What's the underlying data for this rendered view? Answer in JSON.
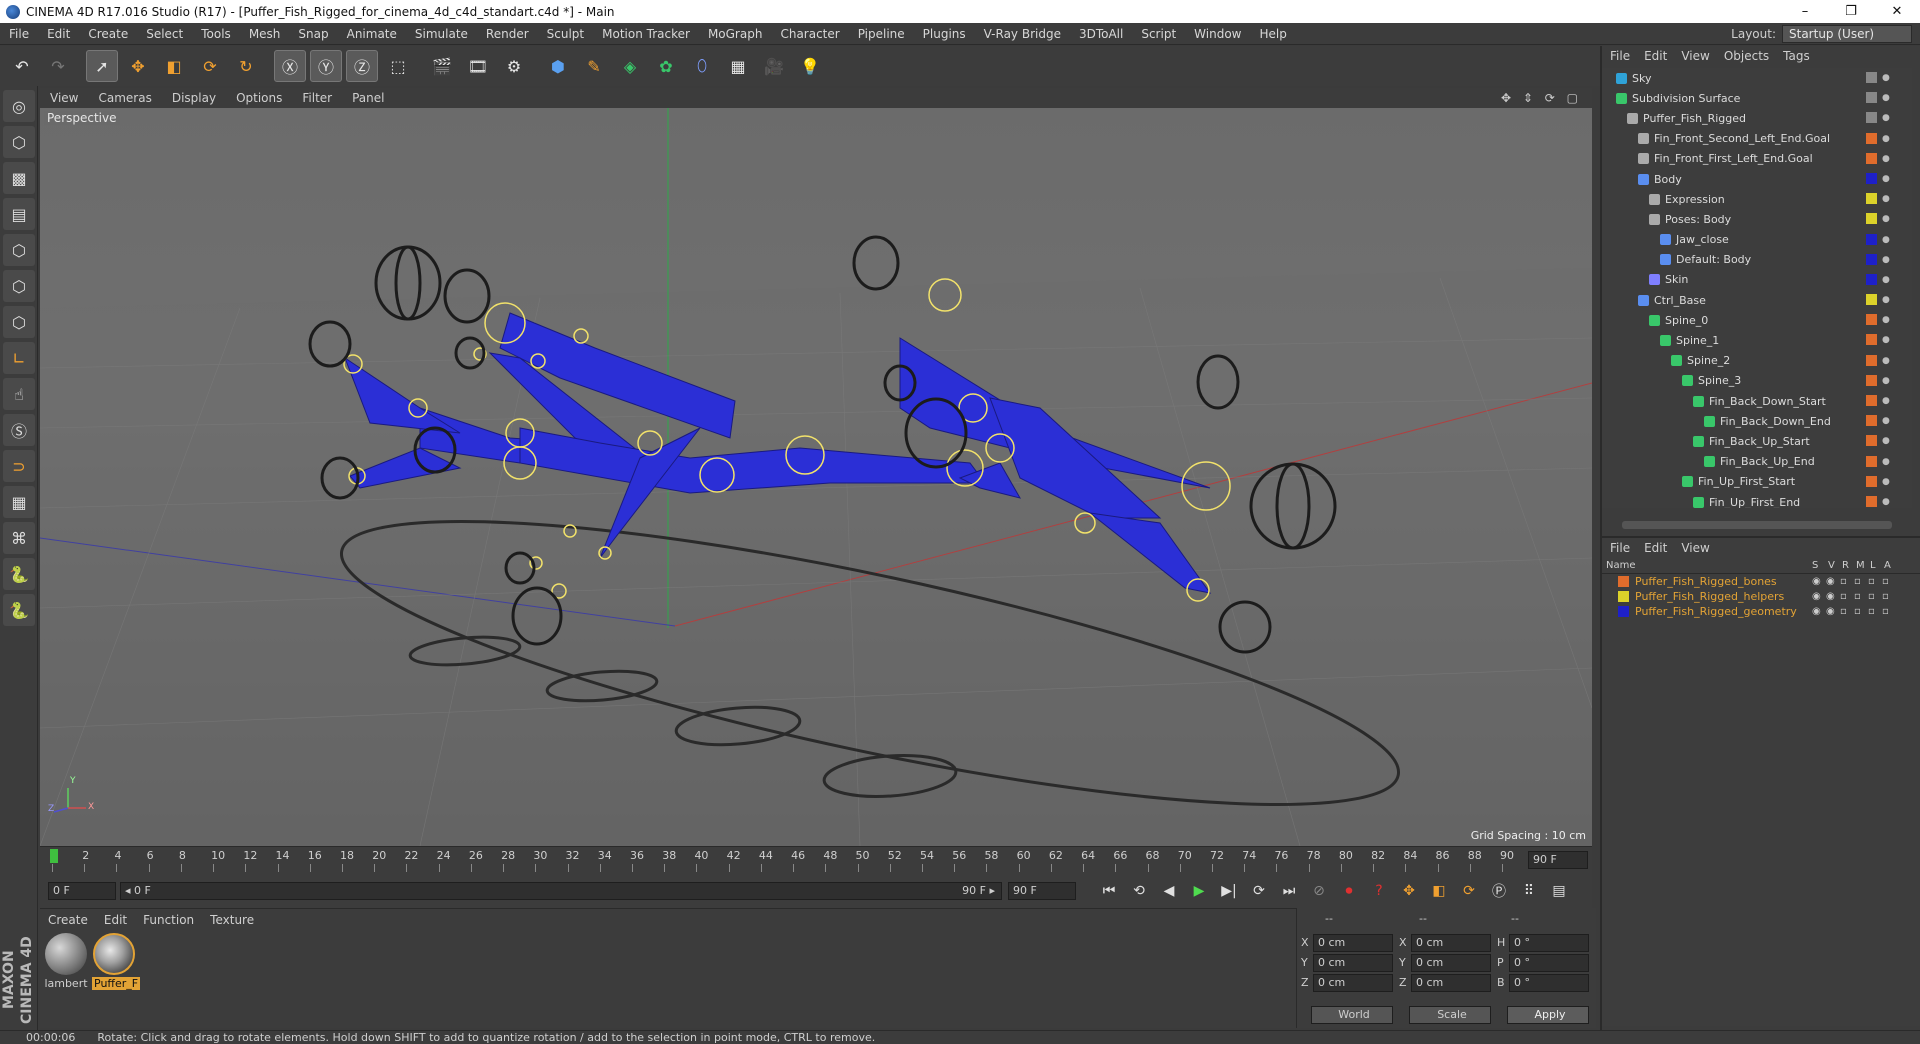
{
  "titlebar": {
    "title": "CINEMA 4D R17.016 Studio (R17) - [Puffer_Fish_Rigged_for_cinema_4d_c4d_standart.c4d *] - Main",
    "minimize": "–",
    "maximize": "❐",
    "close": "✕"
  },
  "menubar": {
    "items": [
      "File",
      "Edit",
      "Create",
      "Select",
      "Tools",
      "Mesh",
      "Snap",
      "Animate",
      "Simulate",
      "Render",
      "Sculpt",
      "Motion Tracker",
      "MoGraph",
      "Character",
      "Pipeline",
      "Plugins",
      "V-Ray Bridge",
      "3DToAll",
      "Script",
      "Window",
      "Help"
    ],
    "layout_label": "Layout:",
    "layout_value": "Startup (User)"
  },
  "viewport": {
    "menu": [
      "View",
      "Cameras",
      "Display",
      "Options",
      "Filter",
      "Panel"
    ],
    "label": "Perspective",
    "grid_spacing": "Grid Spacing : 10 cm",
    "axis_y": "Y",
    "axis_x": "X",
    "axis_z": "Z",
    "nav_icons": "✥ ⇕ ⟳ ▢"
  },
  "timeline": {
    "ticks": [
      "0",
      "2",
      "4",
      "6",
      "8",
      "10",
      "12",
      "14",
      "16",
      "18",
      "20",
      "22",
      "24",
      "26",
      "28",
      "30",
      "32",
      "34",
      "36",
      "38",
      "40",
      "42",
      "44",
      "46",
      "48",
      "50",
      "52",
      "54",
      "56",
      "58",
      "60",
      "62",
      "64",
      "66",
      "68",
      "70",
      "72",
      "74",
      "76",
      "78",
      "80",
      "82",
      "84",
      "86",
      "88",
      "90"
    ],
    "current_frame": "0 F",
    "range_start": "0 F",
    "range_left": "◂ 0 F",
    "range_right": "90 F ▸",
    "range_end": "90 F",
    "end_frame": "90 F"
  },
  "material_panel": {
    "menu": [
      "Create",
      "Edit",
      "Function",
      "Texture"
    ],
    "materials": [
      {
        "name": "lambert",
        "selected": false
      },
      {
        "name": "Puffer_F",
        "selected": true
      }
    ]
  },
  "coords": {
    "header": [
      "--",
      "--",
      "--"
    ],
    "rows": [
      {
        "a": "X",
        "av": "0 cm",
        "b": "X",
        "bv": "0 cm",
        "c": "H",
        "cv": "0 °"
      },
      {
        "a": "Y",
        "av": "0 cm",
        "b": "Y",
        "bv": "0 cm",
        "c": "P",
        "cv": "0 °"
      },
      {
        "a": "Z",
        "av": "0 cm",
        "b": "Z",
        "bv": "0 cm",
        "c": "B",
        "cv": "0 °"
      }
    ],
    "mode1": "World",
    "mode2": "Scale",
    "apply": "Apply"
  },
  "object_manager": {
    "menu": [
      "File",
      "Edit",
      "View",
      "Objects",
      "Tags"
    ],
    "objects": [
      {
        "name": "Sky",
        "indent": 0,
        "icon": "sky",
        "color": "#2fa3d8"
      },
      {
        "name": "Subdivision Surface",
        "indent": 0,
        "icon": "subdiv",
        "color": "#39c76a"
      },
      {
        "name": "Puffer_Fish_Rigged",
        "indent": 1,
        "icon": "null",
        "color": "#aaa"
      },
      {
        "name": "Fin_Front_Second_Left_End.Goal",
        "indent": 2,
        "icon": "null",
        "color": "#aaa"
      },
      {
        "name": "Fin_Front_First_Left_End.Goal",
        "indent": 2,
        "icon": "null",
        "color": "#aaa"
      },
      {
        "name": "Body",
        "indent": 2,
        "icon": "joint",
        "color": "#5a8ef0"
      },
      {
        "name": "Expression",
        "indent": 3,
        "icon": "null",
        "color": "#aaa"
      },
      {
        "name": "Poses: Body",
        "indent": 3,
        "icon": "null",
        "color": "#aaa"
      },
      {
        "name": "Jaw_close",
        "indent": 4,
        "icon": "joint",
        "color": "#5a8ef0"
      },
      {
        "name": "Default: Body",
        "indent": 4,
        "icon": "joint",
        "color": "#5a8ef0"
      },
      {
        "name": "Skin",
        "indent": 3,
        "icon": "skin",
        "color": "#7f7fff"
      },
      {
        "name": "Ctrl_Base",
        "indent": 2,
        "icon": "joint",
        "color": "#5a8ef0"
      },
      {
        "name": "Spine_0",
        "indent": 3,
        "icon": "bone",
        "color": "#39c76a"
      },
      {
        "name": "Spine_1",
        "indent": 4,
        "icon": "bone",
        "color": "#39c76a"
      },
      {
        "name": "Spine_2",
        "indent": 5,
        "icon": "bone",
        "color": "#39c76a"
      },
      {
        "name": "Spine_3",
        "indent": 6,
        "icon": "bone",
        "color": "#39c76a"
      },
      {
        "name": "Fin_Back_Down_Start",
        "indent": 7,
        "icon": "bone",
        "color": "#39c76a"
      },
      {
        "name": "Fin_Back_Down_End",
        "indent": 8,
        "icon": "bone",
        "color": "#39c76a"
      },
      {
        "name": "Fin_Back_Up_Start",
        "indent": 7,
        "icon": "bone",
        "color": "#39c76a"
      },
      {
        "name": "Fin_Back_Up_End",
        "indent": 8,
        "icon": "bone",
        "color": "#39c76a"
      },
      {
        "name": "Fin_Up_First_Start",
        "indent": 6,
        "icon": "bone",
        "color": "#39c76a"
      },
      {
        "name": "Fin_Up_First_End",
        "indent": 7,
        "icon": "bone",
        "color": "#39c76a"
      }
    ],
    "tag_colors": [
      "#888",
      "#888",
      "#888",
      "#e06c2c",
      "#e06c2c",
      "#1e20c8",
      "#dcd22a",
      "#dcd22a",
      "#1e20c8",
      "#1e20c8",
      "#1e20c8",
      "#dcd22a",
      "#e06c2c",
      "#e06c2c",
      "#e06c2c",
      "#e06c2c",
      "#e06c2c",
      "#e06c2c",
      "#e06c2c",
      "#e06c2c",
      "#e06c2c",
      "#e06c2c"
    ]
  },
  "layer_manager": {
    "menu": [
      "File",
      "Edit",
      "View"
    ],
    "columns": [
      "Name",
      "S",
      "V",
      "R",
      "M",
      "L",
      "A"
    ],
    "layers": [
      {
        "name": "Puffer_Fish_Rigged_bones",
        "color": "#e06c2c"
      },
      {
        "name": "Puffer_Fish_Rigged_helpers",
        "color": "#dcd22a"
      },
      {
        "name": "Puffer_Fish_Rigged_geometry",
        "color": "#1e20c8"
      }
    ]
  },
  "statusbar": {
    "time": "00:00:06",
    "message": "Rotate: Click and drag to rotate elements. Hold down SHIFT to add to quantize rotation / add to the selection in point mode, CTRL to remove."
  },
  "brand": {
    "text": "MAXON CINEMA 4D"
  },
  "colors": {
    "rig": "#2b2fd6",
    "joint": "#f2e26b",
    "accent": "#e3a335"
  }
}
